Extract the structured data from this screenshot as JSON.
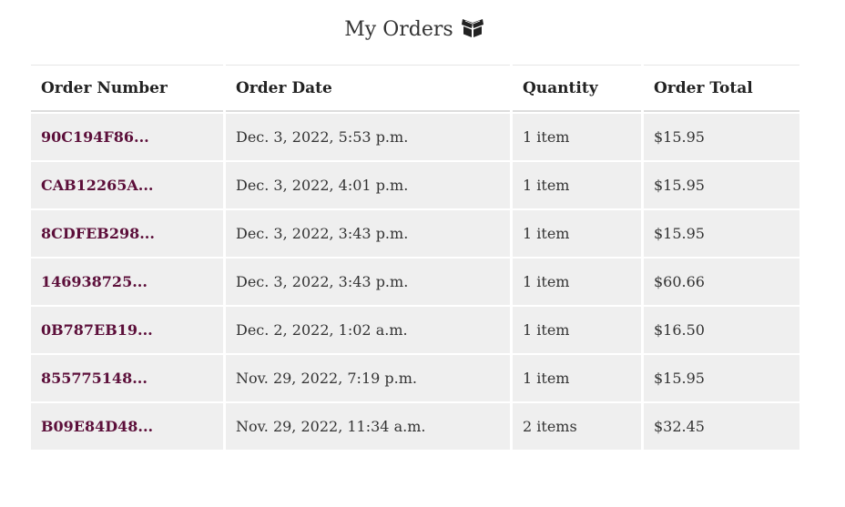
{
  "page": {
    "title": "My Orders",
    "title_icon": "box-icon"
  },
  "table": {
    "headers": [
      "Order Number",
      "Order Date",
      "Quantity",
      "Order Total"
    ],
    "rows": [
      {
        "number": "90C194F86...",
        "date": "Dec. 3, 2022, 5:53 p.m.",
        "quantity": "1 item",
        "total": "$15.95"
      },
      {
        "number": "CAB12265A...",
        "date": "Dec. 3, 2022, 4:01 p.m.",
        "quantity": "1 item",
        "total": "$15.95"
      },
      {
        "number": "8CDFEB298...",
        "date": "Dec. 3, 2022, 3:43 p.m.",
        "quantity": "1 item",
        "total": "$15.95"
      },
      {
        "number": "146938725...",
        "date": "Dec. 3, 2022, 3:43 p.m.",
        "quantity": "1 item",
        "total": "$60.66"
      },
      {
        "number": "0B787EB19...",
        "date": "Dec. 2, 2022, 1:02 a.m.",
        "quantity": "1 item",
        "total": "$16.50"
      },
      {
        "number": "855775148...",
        "date": "Nov. 29, 2022, 7:19 p.m.",
        "quantity": "1 item",
        "total": "$15.95"
      },
      {
        "number": "B09E84D48...",
        "date": "Nov. 29, 2022, 11:34 a.m.",
        "quantity": "2 items",
        "total": "$32.45"
      }
    ]
  },
  "colors": {
    "link": "#5c0f3a",
    "row_background": "#efefef"
  }
}
